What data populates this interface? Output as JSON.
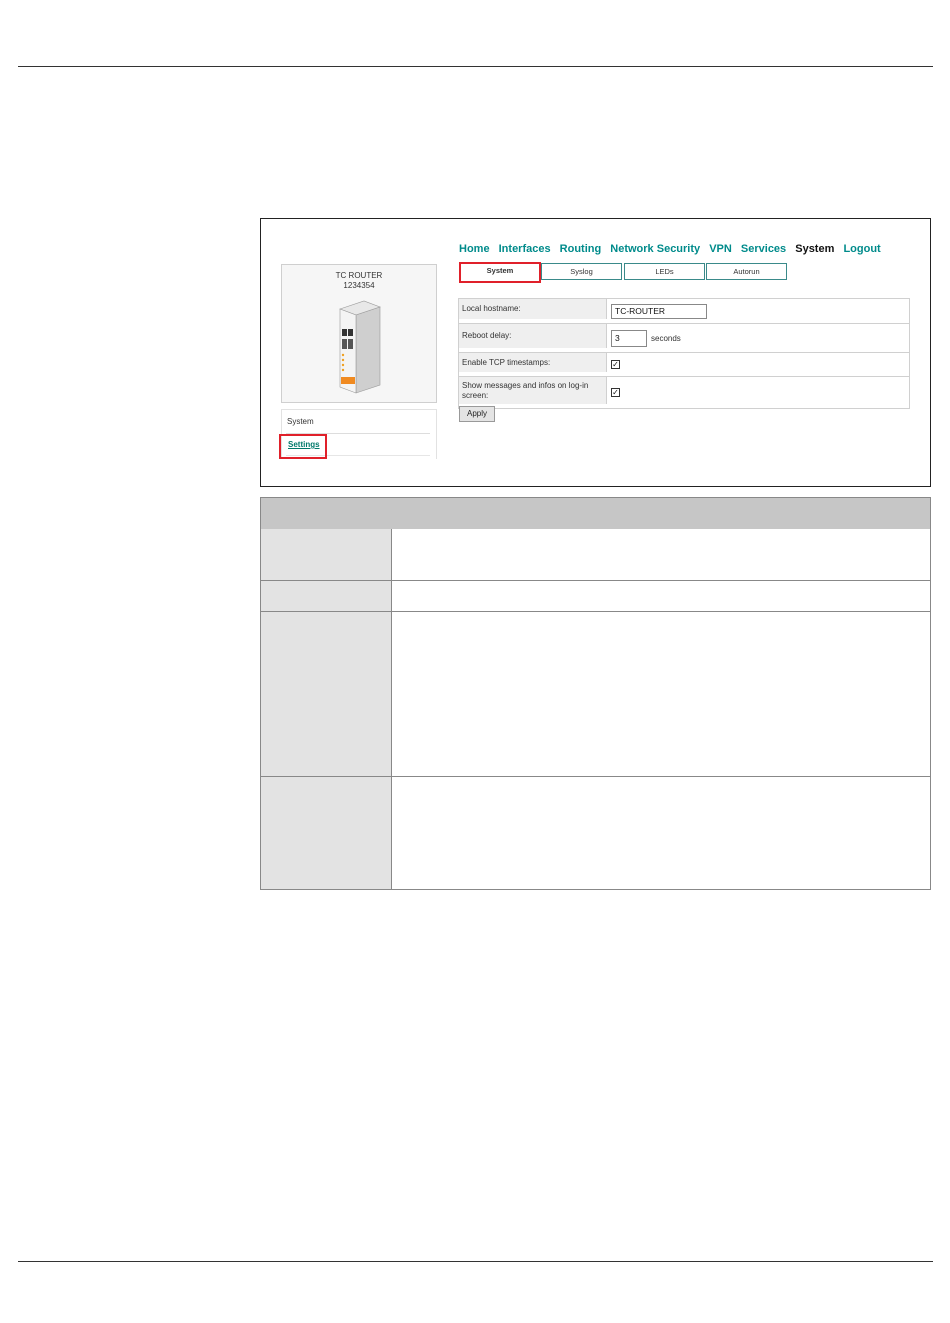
{
  "device": {
    "name": "TC ROUTER",
    "id": "1234354"
  },
  "side_menu": {
    "heading": "System",
    "link": "Settings"
  },
  "nav": {
    "items": [
      "Home",
      "Interfaces",
      "Routing",
      "Network Security",
      "VPN",
      "Services",
      "System",
      "Logout"
    ],
    "active": "System"
  },
  "tabs": [
    "System",
    "Syslog",
    "LEDs",
    "Autorun"
  ],
  "form": {
    "hostname_label": "Local hostname:",
    "hostname_value": "TC-ROUTER",
    "reboot_label": "Reboot delay:",
    "reboot_value": "3",
    "reboot_unit": "seconds",
    "tcp_label": "Enable TCP timestamps:",
    "tcp_checked": true,
    "messages_label": "Show messages and infos on log-in screen:",
    "messages_checked": true
  },
  "apply_label": "Apply",
  "colors": {
    "nav_link": "#008b8b",
    "highlight": "#e0202a",
    "table_header": "#c6c6c6"
  }
}
